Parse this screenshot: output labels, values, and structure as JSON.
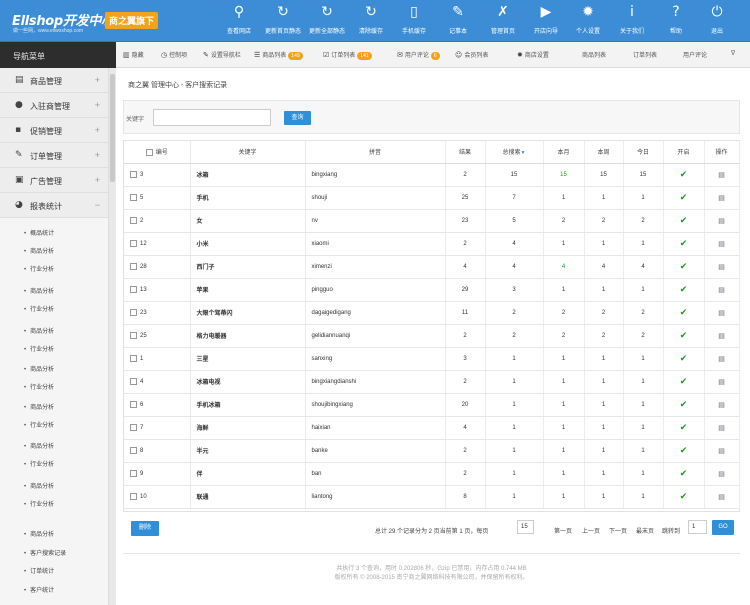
{
  "header": {
    "logo": "Ellshop开发中心",
    "logo_sub": "做一些网，www.ellwoshop.com",
    "badge": "商之翼旗下",
    "actions": [
      {
        "label": "查看网店",
        "icon": "search-icon"
      },
      {
        "label": "更新首页静态",
        "icon": "refresh-icon"
      },
      {
        "label": "更新全部静态",
        "icon": "refresh-icon"
      },
      {
        "label": "清除缓存",
        "icon": "refresh-icon"
      },
      {
        "label": "手机缓存",
        "icon": "mobile-icon"
      },
      {
        "label": "记事本",
        "icon": "pen-icon"
      },
      {
        "label": "管理首页",
        "icon": "wrench-icon"
      },
      {
        "label": "开店向导",
        "icon": "play-icon"
      },
      {
        "label": "个人设置",
        "icon": "gear-icon"
      },
      {
        "label": "关于我们",
        "icon": "info-icon"
      },
      {
        "label": "帮助",
        "icon": "help-icon"
      },
      {
        "label": "退出",
        "icon": "power-icon"
      }
    ]
  },
  "nav_title": "导航菜单",
  "menubar": {
    "items": [
      {
        "label": "隐藏",
        "icon": "columns-icon"
      },
      {
        "label": "控制项",
        "icon": "clock-icon"
      },
      {
        "label": "设置导航栏",
        "icon": "edit-icon"
      },
      {
        "label": "商品列表",
        "icon": "list-icon",
        "count": "149"
      },
      {
        "label": "订单列表",
        "icon": "checkbox-icon",
        "count": "141"
      },
      {
        "label": "用户评论",
        "icon": "comment-icon",
        "count": "6"
      },
      {
        "label": "会员列表",
        "icon": "user-icon"
      },
      {
        "label": "商店设置",
        "icon": "gear-icon"
      },
      {
        "label": "商品列表"
      },
      {
        "label": "订单列表"
      },
      {
        "label": "用户评论"
      }
    ],
    "more": "ᐁ"
  },
  "sidebar": {
    "sections": [
      {
        "label": "商品管理",
        "icon": "document-icon",
        "toggle": "+"
      },
      {
        "label": "入驻商管理",
        "icon": "chat-icon",
        "toggle": "+"
      },
      {
        "label": "促销管理",
        "icon": "cart-icon",
        "toggle": "+"
      },
      {
        "label": "订单管理",
        "icon": "edit-icon",
        "toggle": "+"
      },
      {
        "label": "广告管理",
        "icon": "image-icon",
        "toggle": "+"
      },
      {
        "label": "报表统计",
        "icon": "pie-icon",
        "toggle": "−"
      }
    ],
    "subitems": [
      "概品统计",
      "商品分析",
      "行业分析",
      "商品分析",
      "行业分析",
      "商品分析",
      "行业分析",
      "商品分析",
      "行业分析",
      "商品分析",
      "行业分析",
      "商品分析",
      "行业分析",
      "商品分析",
      "行业分析",
      "商品分析",
      "客户搜索记录",
      "订单统计",
      "客户统计"
    ]
  },
  "breadcrumb": "商之翼 管理中心 - 客户搜索记录",
  "search": {
    "label": "关键字",
    "value": "",
    "button": "查询"
  },
  "table": {
    "headers": [
      "编号",
      "关键字",
      "拼音",
      "结果",
      "总搜索",
      "本月",
      "本周",
      "今日",
      "开启",
      "操作"
    ],
    "sort_glyph": "▼",
    "rows": [
      [
        "3",
        "冰箱",
        "bingxiang",
        "2",
        "15",
        "15",
        "15",
        "15"
      ],
      [
        "5",
        "手机",
        "shouji",
        "25",
        "7",
        "1",
        "1",
        "1"
      ],
      [
        "2",
        "女",
        "nv",
        "23",
        "5",
        "2",
        "2",
        "2"
      ],
      [
        "12",
        "小米",
        "xiaomi",
        "2",
        "4",
        "1",
        "1",
        "1"
      ],
      [
        "28",
        "西门子",
        "ximenzi",
        "4",
        "4",
        "4",
        "4",
        "4"
      ],
      [
        "13",
        "苹果",
        "pingguo",
        "29",
        "3",
        "1",
        "1",
        "1"
      ],
      [
        "23",
        "大眼个驾蒂闪",
        "dagaigedigang",
        "11",
        "2",
        "2",
        "2",
        "2"
      ],
      [
        "25",
        "格力电暖器",
        "gelidiannuanqi",
        "2",
        "2",
        "2",
        "2",
        "2"
      ],
      [
        "1",
        "三星",
        "sanxing",
        "3",
        "1",
        "1",
        "1",
        "1"
      ],
      [
        "4",
        "冰箱电视",
        "bingxiangdianshi",
        "2",
        "1",
        "1",
        "1",
        "1"
      ],
      [
        "6",
        "手机冰箱",
        "shoujibingxiang",
        "20",
        "1",
        "1",
        "1",
        "1"
      ],
      [
        "7",
        "海鲜",
        "haixian",
        "4",
        "1",
        "1",
        "1",
        "1"
      ],
      [
        "8",
        "半元",
        "banke",
        "2",
        "1",
        "1",
        "1",
        "1"
      ],
      [
        "9",
        "伴",
        "ban",
        "2",
        "1",
        "1",
        "1",
        "1"
      ],
      [
        "10",
        "联通",
        "liantong",
        "8",
        "1",
        "1",
        "1",
        "1"
      ]
    ],
    "green_month_rows": [
      0,
      4
    ],
    "enabled_glyph": "✔",
    "edit_glyph": "▤"
  },
  "footer_actions": {
    "delete": "删除",
    "summary": "总计 29 个记录分为 2 页当前第 1 页，每页",
    "per_page": "15",
    "first": "第一页",
    "prev": "上一页",
    "next": "下一页",
    "last": "最末页",
    "jump_label": "跳转到",
    "jump_value": "1",
    "go": "GO"
  },
  "footer": {
    "line1": "共执行 3 个查询，用时 0.202806 秒，Gzip 已禁用，内存占用 0.744 MB",
    "line2": "版权所有 © 2008-2015 南宁商之翼网络科技有限公司，并保留所有权利。"
  }
}
